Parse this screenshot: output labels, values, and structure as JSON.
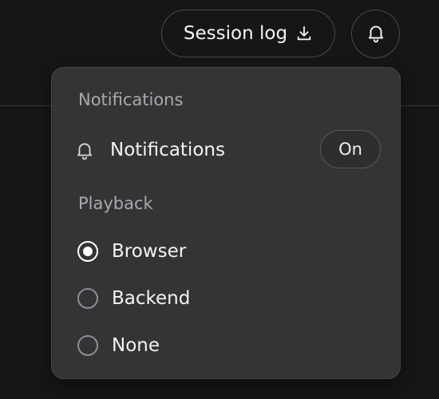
{
  "header": {
    "session_log_label": "Session log",
    "download_icon": "download-icon",
    "bell_icon": "bell-icon"
  },
  "menu": {
    "notifications_heading": "Notifications",
    "notifications_row_label": "Notifications",
    "notifications_toggle_value": "On",
    "playback_heading": "Playback",
    "playback_options": [
      {
        "label": "Browser",
        "selected": true
      },
      {
        "label": "Backend",
        "selected": false
      },
      {
        "label": "None",
        "selected": false
      }
    ]
  },
  "colors": {
    "page_background": "#161617",
    "panel_background": "#343436",
    "heading_text": "#a9a9ad",
    "primary_text": "#f4f4f4"
  }
}
